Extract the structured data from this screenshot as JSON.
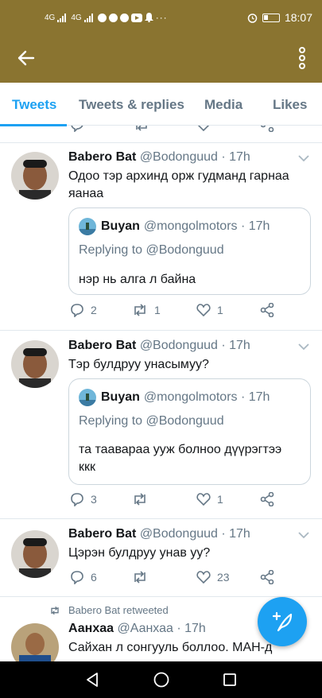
{
  "status_bar": {
    "network_1": "4G",
    "network_2": "4G",
    "time": "18:07",
    "icons": [
      "signal-icon",
      "wifi-icon",
      "messenger-icon",
      "facebook-icon",
      "youtube-icon",
      "notification-icon",
      "more-icon",
      "alarm-icon",
      "battery-icon"
    ]
  },
  "tabs": [
    {
      "label": "Tweets",
      "active": true
    },
    {
      "label": "Tweets & replies",
      "active": false
    },
    {
      "label": "Media",
      "active": false
    },
    {
      "label": "Likes",
      "active": false
    }
  ],
  "tweets": [
    {
      "name": "Babero Bat",
      "handle": "@Bodonguud · 17h",
      "text": "Одоо тэр архинд орж гудманд гарнаа яанаа",
      "quote": {
        "name": "Buyan",
        "handle": "@mongolmotors · 17h",
        "replying": "Replying to @Bodonguud",
        "text": "нэр нь алга л байна"
      },
      "replies": "2",
      "retweets": "1",
      "likes": "1"
    },
    {
      "name": "Babero Bat",
      "handle": "@Bodonguud · 17h",
      "text": "Тэр булдруу унасымуу?",
      "quote": {
        "name": "Buyan",
        "handle": "@mongolmotors · 17h",
        "replying": "Replying to @Bodonguud",
        "text": "та таавараа ууж болноо дүүрэгтээ ккк"
      },
      "replies": "3",
      "retweets": "",
      "likes": "1"
    },
    {
      "name": "Babero Bat",
      "handle": "@Bodonguud · 17h",
      "text": "Цэрэн булдруу унав уу?",
      "replies": "6",
      "retweets": "",
      "likes": "23"
    }
  ],
  "retweet_notice": "Babero Bat retweeted",
  "partial_tweet": {
    "name": "Аанхаа",
    "handle": "@Аанхаа · 17h",
    "text": "Сайхан л сонгууль боллоо. МАН-д"
  },
  "accent_color": "#1da1f2",
  "header_color": "#8a7430"
}
